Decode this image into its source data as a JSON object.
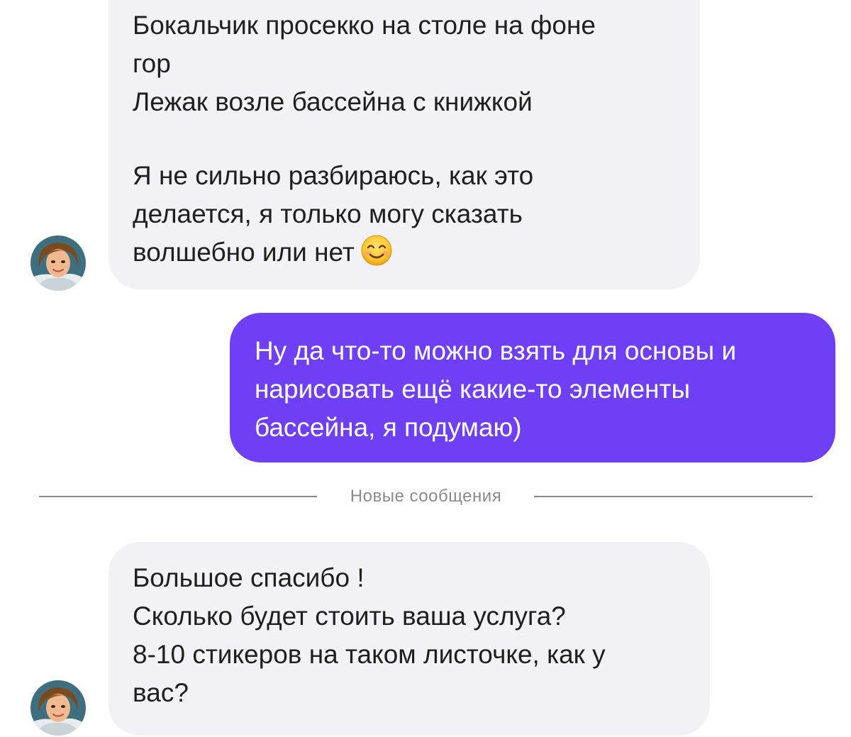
{
  "messages": [
    {
      "direction": "incoming",
      "lines": [
        "Бокальчик просекко на столе  на фоне",
        "гор",
        "Лежак возле бассейна с книжкой",
        "",
        "Я не сильно  разбираюсь, как это",
        "делается, я только могу сказать",
        "волшебно или нет"
      ],
      "emoji": "smiling-face-icon"
    },
    {
      "direction": "outgoing",
      "lines": [
        "Ну да что-то можно взять для основы и",
        "нарисовать ещё какие-то элементы",
        "бассейна, я подумаю)"
      ]
    },
    {
      "direction": "incoming",
      "lines": [
        "Большое спасибо !",
        "Сколько будет стоить ваша услуга?",
        "8-10 стикеров на таком листочке, как у",
        "вас?"
      ]
    }
  ],
  "divider": {
    "label": "Новые сообщения"
  },
  "colors": {
    "incoming_bubble": "#f2f2f6",
    "outgoing_bubble": "#6e3ff5",
    "divider": "#8a8a8e"
  }
}
